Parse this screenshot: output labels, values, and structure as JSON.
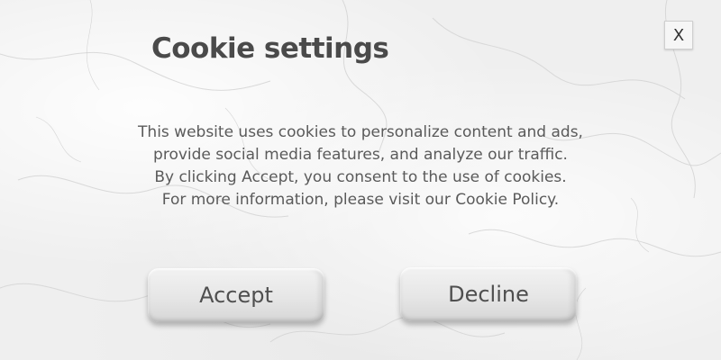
{
  "dialog": {
    "title": "Cookie settings",
    "close_label": "X",
    "message_lines": [
      "This website uses cookies to personalize content and ads,",
      "provide social media features, and analyze our traffic.",
      "By clicking Accept, you consent to the use of cookies.",
      "For more information, please visit our Cookie Policy."
    ],
    "accept_label": "Accept",
    "decline_label": "Decline"
  },
  "colors": {
    "title": "#4a4a4a",
    "body_text": "#5a5a5a",
    "button_text": "#4f4f4f",
    "background": "#efefef"
  }
}
